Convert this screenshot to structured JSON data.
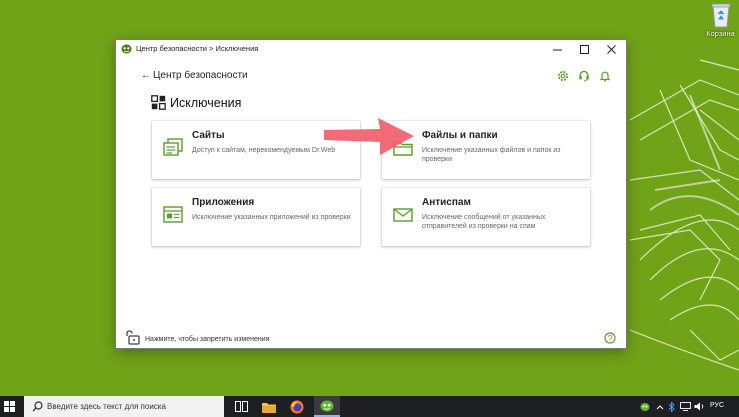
{
  "desktop": {
    "recycle_bin_label": "Корзина"
  },
  "window": {
    "title": "Центр безопасности > Исключения",
    "back_label": "Центр безопасности",
    "page_title": "Исключения",
    "cards": {
      "sites": {
        "title": "Сайты",
        "description": "Доступ к сайтам, нерекомендуемым Dr.Web"
      },
      "files": {
        "title": "Файлы и папки",
        "description": "Исключение указанных файлов и папок из проверки"
      },
      "apps": {
        "title": "Приложения",
        "description": "Исключение указанных приложений из проверки"
      },
      "antispam": {
        "title": "Антиспам",
        "description": "Исключение сообщений от указанных отправителей из проверки на спам"
      }
    },
    "footer_text": "Нажмите, чтобы запретить изменения"
  },
  "taskbar": {
    "search_placeholder": "Введите здесь текст для поиска",
    "language": "РУС"
  },
  "colors": {
    "desktop": "#70a318",
    "accent_green": "#5c9c2a",
    "arrow": "#f0606a",
    "taskbar": "#1e1f22"
  },
  "icons": {
    "app": "drweb-spider-icon",
    "sites": "web-pages-icon",
    "files": "folder-icon",
    "apps": "application-window-icon",
    "antispam": "envelope-icon",
    "lock": "lock-open-icon",
    "help": "help-icon"
  }
}
